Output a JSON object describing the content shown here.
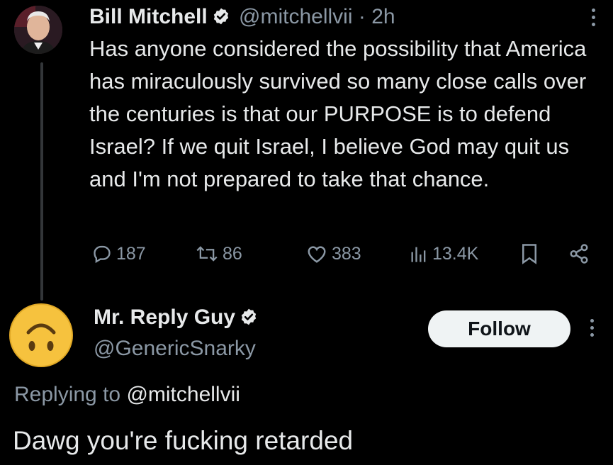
{
  "parent_tweet": {
    "author_name": "Bill Mitchell",
    "author_handle": "@mitchellvii",
    "separator": "·",
    "timestamp": "2h",
    "text": "Has anyone considered the possibility that America has miraculously survived so many close calls over the centuries is that our PURPOSE is to defend Israel?  If we quit Israel, I believe God may quit us and I'm not prepared to take that chance.",
    "replies": "187",
    "reposts": "86",
    "likes": "383",
    "views": "13.4K"
  },
  "reply_tweet": {
    "author_name": "Mr. Reply Guy",
    "author_handle": "@GenericSnarky",
    "follow_label": "Follow",
    "replying_prefix": "Replying to",
    "replying_handle": "@mitchellvii",
    "text": "Dawg you're fucking retarded"
  },
  "icons": {
    "verified": "verified-badge-icon",
    "reply": "reply-icon",
    "repost": "repost-icon",
    "like": "heart-icon",
    "views": "bar-chart-icon",
    "bookmark": "bookmark-icon",
    "share": "share-icon",
    "more": "more-icon"
  },
  "colors": {
    "background": "#000000",
    "text": "#e7e9ea",
    "secondary": "#8b98a5",
    "follow_bg": "#eff3f4",
    "avatar_emoji": "#f6c23e"
  }
}
